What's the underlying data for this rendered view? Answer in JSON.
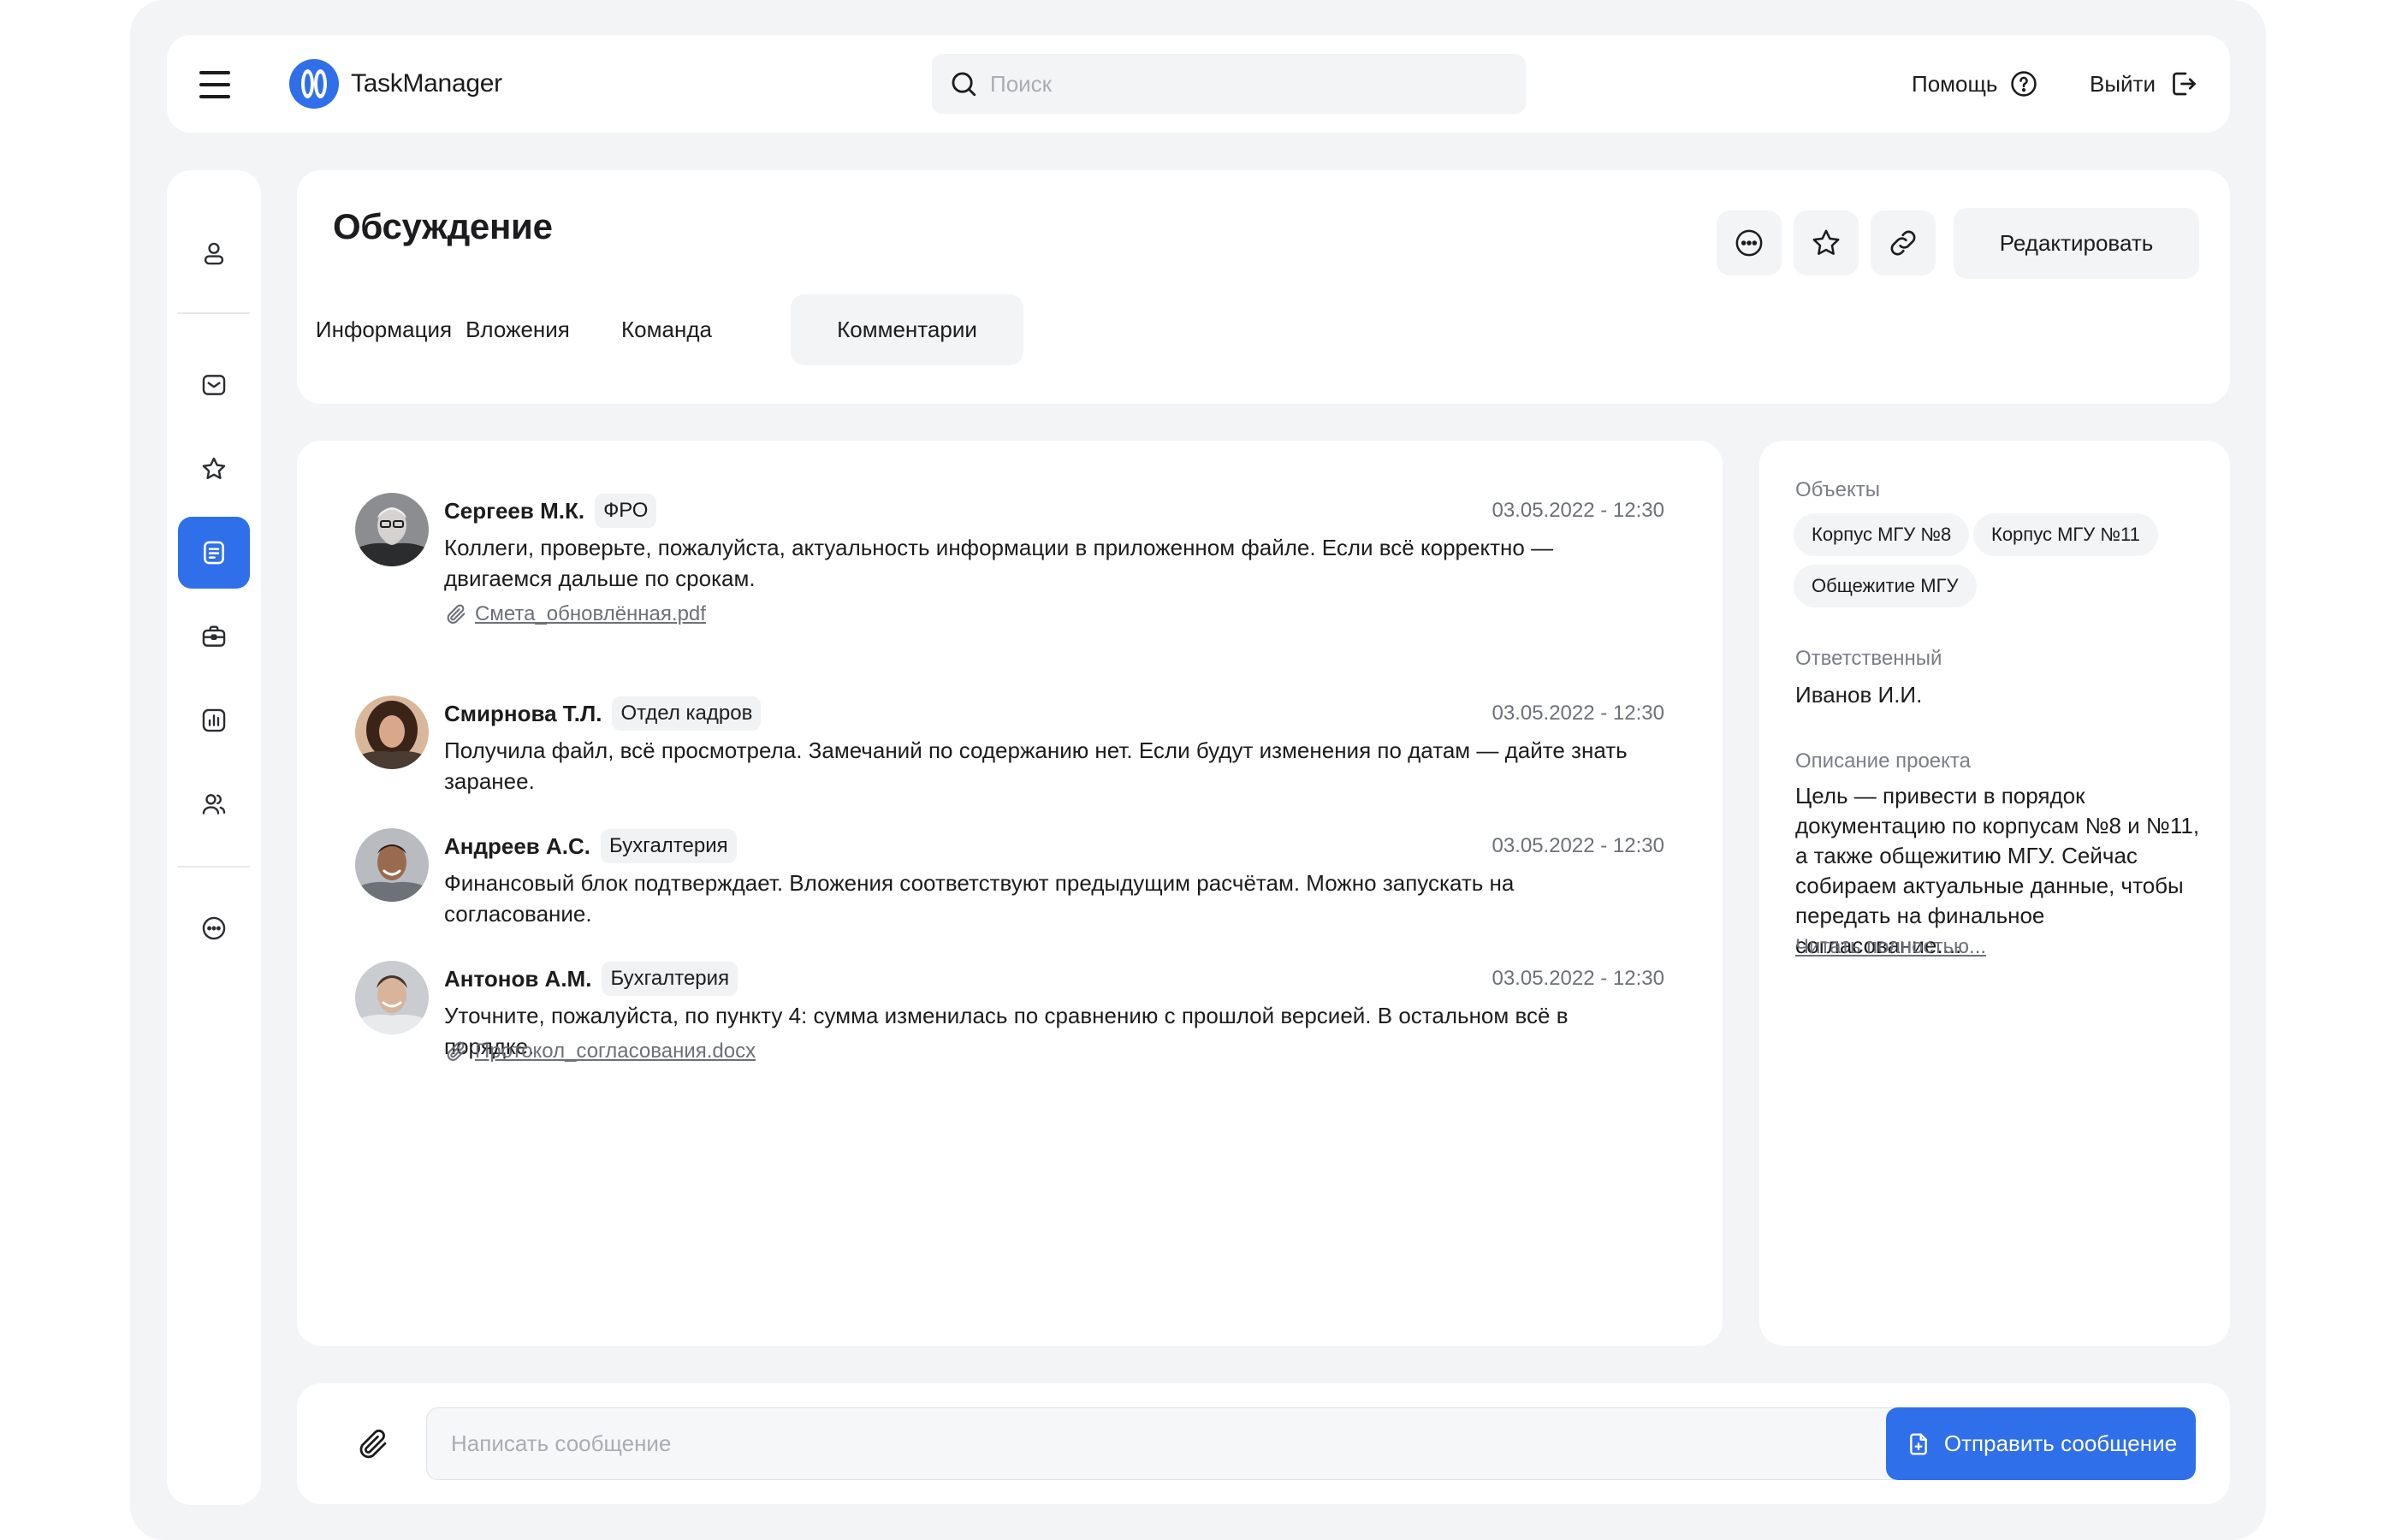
{
  "app": {
    "name": "TaskManager"
  },
  "header": {
    "search_placeholder": "Поиск",
    "help_label": "Помощь",
    "logout_label": "Выйти"
  },
  "sidebar": {
    "items": [
      {
        "icon": "user-icon"
      },
      {
        "icon": "mail-icon"
      },
      {
        "icon": "star-icon"
      },
      {
        "icon": "document-icon",
        "active": true
      },
      {
        "icon": "briefcase-icon"
      },
      {
        "icon": "chart-icon"
      },
      {
        "icon": "users-icon"
      },
      {
        "icon": "chat-icon"
      }
    ]
  },
  "page": {
    "title": "Обсуждение",
    "edit_label": "Редактировать",
    "tabs": [
      {
        "label": "Информация"
      },
      {
        "label": "Вложения"
      },
      {
        "label": "Команда"
      },
      {
        "label": "Комментарии",
        "active": true
      }
    ]
  },
  "comments": [
    {
      "name": "Сергеев М.К.",
      "dept": "ФРО",
      "time": "03.05.2022 - 12:30",
      "text": "Коллеги, проверьте, пожалуйста, актуальность информации в приложенном файле. Если всё корректно — двигаемся дальше по срокам.",
      "attachment": "Смета_обновлённая.pdf"
    },
    {
      "name": "Смирнова Т.Л.",
      "dept": "Отдел кадров",
      "time": "03.05.2022 - 12:30",
      "text": "Получила файл, всё просмотрела. Замечаний по содержанию нет. Если будут изменения по датам — дайте знать заранее."
    },
    {
      "name": "Андреев А.С.",
      "dept": "Бухгалтерия",
      "time": "03.05.2022 - 12:30",
      "text": "Финансовый блок подтверждает. Вложения соответствуют предыдущим расчётам. Можно запускать на согласование."
    },
    {
      "name": "Антонов А.М.",
      "dept": "Бухгалтерия",
      "time": "03.05.2022 - 12:30",
      "text": "Уточните, пожалуйста, по пункту 4: сумма изменилась по сравнению с прошлой версией. В остальном всё в порядке.",
      "attachment": "Протокол_согласования.docx"
    }
  ],
  "details": {
    "objects_label": "Объекты",
    "objects": [
      "Корпус МГУ №8",
      "Корпус МГУ №11",
      "Общежитие МГУ"
    ],
    "responsible_label": "Ответственный",
    "responsible": "Иванов И.И.",
    "description_label": "Описание проекта",
    "description": "Цель — привести в порядок документацию по корпусам №8 и №11, а также общежитию МГУ. Сейчас собираем актуальные данные, чтобы передать на финальное согласование....",
    "read_more": "Читать полностью..."
  },
  "composer": {
    "placeholder": "Написать сообщение",
    "send_label": "Отправить сообщение"
  },
  "colors": {
    "accent": "#2f6fea",
    "background": "#f3f4f6",
    "card": "#ffffff"
  }
}
